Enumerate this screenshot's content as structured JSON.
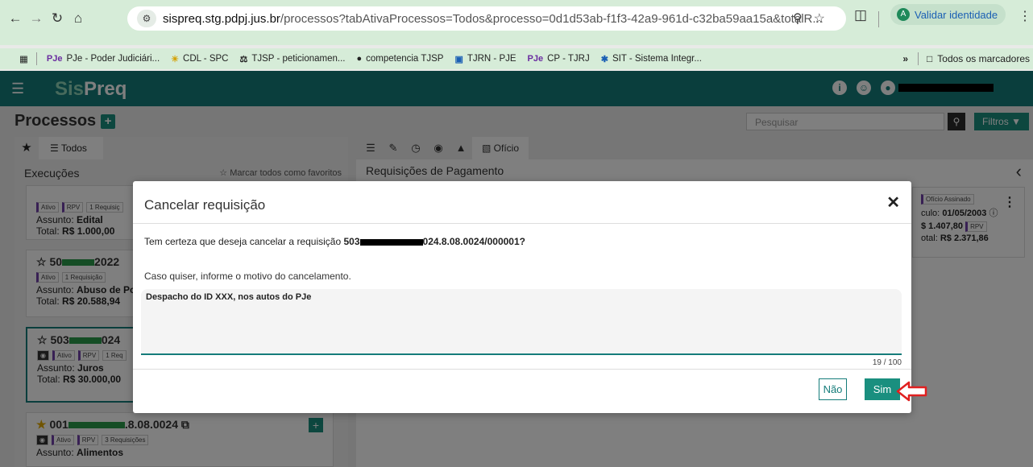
{
  "browser": {
    "url_host": "sispreq.stg.pdpj.jus.br",
    "url_path": "/processos?tabAtivaProcessos=Todos&processo=0d1d53ab-f1f3-42a9-961d-c32ba59aa15a&totalR...",
    "validate_label": "Validar identidade",
    "bookmarks": [
      "PJe - Poder Judiciári...",
      "CDL - SPC",
      "TJSP - peticionamen...",
      "competencia TJSP",
      "TJRN - PJE",
      "CP - TJRJ",
      "SIT - Sistema Integr..."
    ],
    "bookmark_icons": [
      "PJe",
      "☀",
      "⚖",
      "●",
      "▣",
      "PJe",
      "✱"
    ],
    "more_label": "»",
    "all_bookmarks_label": "Todos os marcadores"
  },
  "app": {
    "logo_sis": "Sis",
    "logo_preq": "Preq",
    "page_title": "Processos",
    "search_placeholder": "Pesquisar",
    "filters_label": "Filtros",
    "left": {
      "tab_todos": "Todos",
      "heading": "Execuções",
      "fav_all": "Marcar todos como favoritos",
      "cards": [
        {
          "number": "",
          "badges": [
            "Ativo",
            "RPV",
            "1 Requisiç"
          ],
          "subject_label": "Assunto:",
          "subject": "Edital",
          "total_label": "Total:",
          "total": "R$ 1.000,00"
        },
        {
          "number": "50",
          "number_tail": "2022",
          "badges": [
            "Ativo",
            "1 Requisição"
          ],
          "subject_label": "Assunto:",
          "subject": "Abuso de Poc",
          "total_label": "Total:",
          "total": "R$ 20.588,94"
        },
        {
          "number": "503",
          "number_tail": "024",
          "badges": [
            "Ativo",
            "RPV",
            "1 Req"
          ],
          "subject_label": "Assunto:",
          "subject": "Juros",
          "total_label": "Total:",
          "total": "R$ 30.000,00"
        },
        {
          "number": "001",
          "number_tail": ".8.08.0024",
          "badges": [
            "Ativo",
            "RPV",
            "3 Requisições"
          ],
          "subject_label": "Assunto:",
          "subject": "Alimentos"
        }
      ]
    },
    "right": {
      "tab_oficio": "Ofício",
      "heading": "Requisições de Pagamento",
      "card": {
        "badge": "Ofício Assinado",
        "line1_label": "culo:",
        "line1_value": "01/05/2003",
        "line2_value": "$ 1.407,80",
        "line2_badge": "RPV",
        "line3_label": "otal:",
        "line3_value": "R$ 2.371,86"
      }
    }
  },
  "modal": {
    "title": "Cancelar requisição",
    "question_prefix": "Tem certeza que deseja cancelar a requisição",
    "req_start": "503",
    "req_end": "024.8.08.0024/000001?",
    "info": "Caso quiser, informe o motivo do cancelamento.",
    "reason_value": "Despacho do ID XXX, nos autos do PJe",
    "counter": "19 / 100",
    "no_label": "Não",
    "yes_label": "Sim"
  },
  "colors": {
    "teal": "#157c7a",
    "accent": "#1a8f7f",
    "arrow": "#e02020"
  }
}
